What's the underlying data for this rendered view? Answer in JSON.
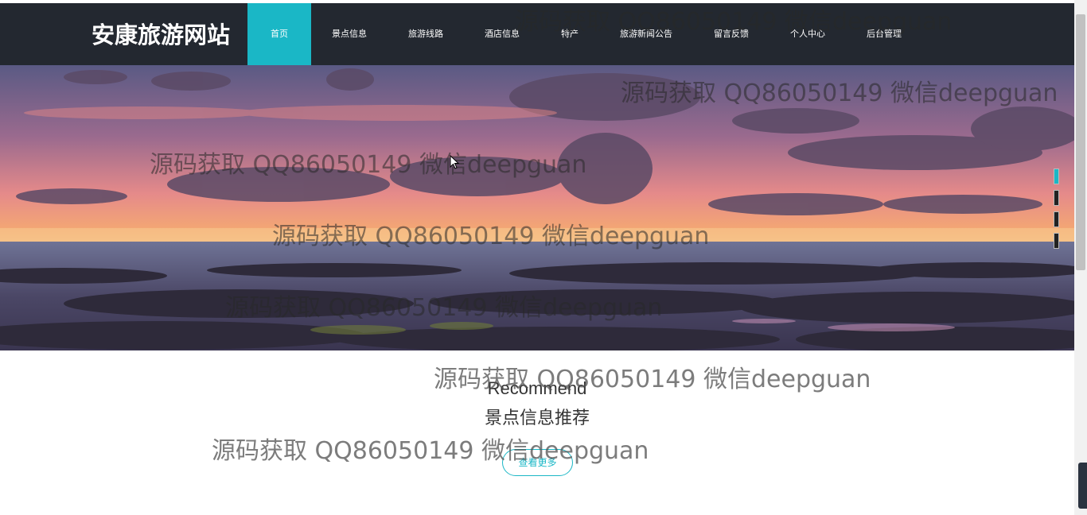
{
  "header": {
    "logo": "安康旅游网站",
    "nav": [
      {
        "label": "首页",
        "active": true
      },
      {
        "label": "景点信息"
      },
      {
        "label": "旅游线路"
      },
      {
        "label": "酒店信息"
      },
      {
        "label": "特产"
      },
      {
        "label": "旅游新闻公告"
      },
      {
        "label": "留言反馈"
      },
      {
        "label": "个人中心"
      },
      {
        "label": "后台管理"
      }
    ]
  },
  "section": {
    "title_en": "Recommend",
    "title_cn": "景点信息推荐",
    "more_label": "查看更多"
  },
  "watermark": "源码获取 QQ86050149 微信deepguan",
  "carousel": {
    "slides": 4,
    "active_index": 0
  },
  "colors": {
    "header_bg": "#232830",
    "accent": "#1ab7c6"
  }
}
